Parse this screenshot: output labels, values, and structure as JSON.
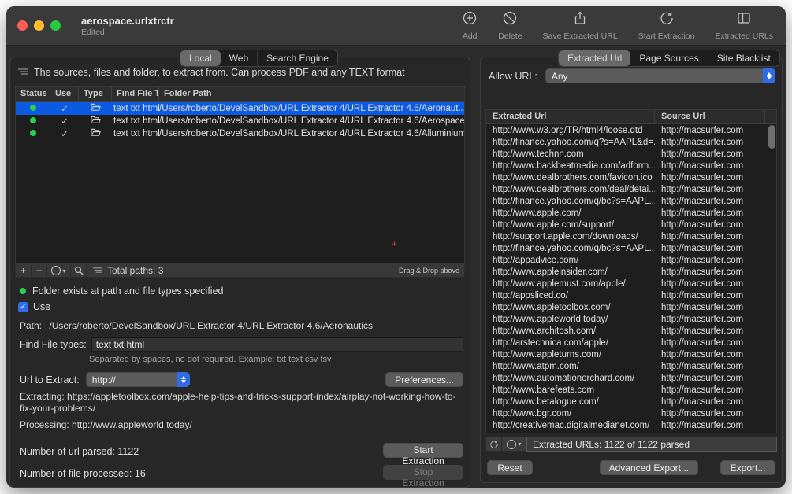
{
  "window": {
    "title": "aerospace.urlxtrctr",
    "subtitle": "Edited"
  },
  "toolbar": {
    "items": [
      {
        "label": "Add",
        "icon": "add-icon"
      },
      {
        "label": "Delete",
        "icon": "delete-icon"
      },
      {
        "label": "Save Extracted URL",
        "icon": "share-icon"
      },
      {
        "label": "Start Extraction",
        "icon": "refresh-icon"
      },
      {
        "label": "Extracted URLs",
        "icon": "columns-icon"
      }
    ]
  },
  "left": {
    "tabs": [
      {
        "label": "Local",
        "selected": true
      },
      {
        "label": "Web",
        "selected": false
      },
      {
        "label": "Search Engine",
        "selected": false
      }
    ],
    "description": "The sources, files and folder, to extract from. Can process PDF and any TEXT format",
    "table": {
      "columns": [
        "Status",
        "Use",
        "Type",
        "Find File Type",
        "Folder Path"
      ],
      "rows": [
        {
          "status": "green",
          "use": true,
          "type": "folder",
          "file_types": "text txt html",
          "path": "/Users/roberto/DevelSandbox/URL Extractor 4/URL Extractor 4.6/Aeronaut...",
          "selected": true
        },
        {
          "status": "green",
          "use": true,
          "type": "folder",
          "file_types": "text txt html",
          "path": "/Users/roberto/DevelSandbox/URL Extractor 4/URL Extractor 4.6/Aerospace",
          "selected": false
        },
        {
          "status": "green",
          "use": true,
          "type": "folder",
          "file_types": "text txt html",
          "path": "/Users/roberto/DevelSandbox/URL Extractor 4/URL Extractor 4.6/Alluminium",
          "selected": false
        }
      ]
    },
    "table_footer": {
      "add": "+",
      "remove": "−",
      "total": "Total paths: 3",
      "drag_hint": "Drag & Drop above"
    },
    "status_line": "Folder exists at path and file types specified",
    "use_checkbox": {
      "label": "Use",
      "checked": true
    },
    "path_label": "Path:",
    "path_value": "/Users/roberto/DevelSandbox/URL Extractor 4/URL Extractor 4.6/Aeronautics",
    "find_file_types": {
      "label": "Find File types:",
      "value": "text txt html",
      "hint": "Separated by spaces, no dot required. Example: txt text csv tsv"
    },
    "url_to_extract": {
      "label": "Url to Extract:",
      "value": "http://",
      "preferences_label": "Preferences..."
    },
    "extracting": "Extracting: https://appletoolbox.com/apple-help-tips-and-tricks-support-index/airplay-not-working-how-to-fix-your-problems/",
    "processing": "Processing: http://www.appleworld.today/",
    "url_parsed": "Number of url parsed: 1122",
    "files_processed": "Number of file processed: 16",
    "start_button": "Start Extraction",
    "stop_button": "Stop Extraction"
  },
  "right": {
    "tabs": [
      {
        "label": "Extracted Url",
        "selected": true
      },
      {
        "label": "Page Sources",
        "selected": false
      },
      {
        "label": "Site Blacklist",
        "selected": false
      }
    ],
    "allow_url": {
      "label": "Allow URL:",
      "value": "Any"
    },
    "table": {
      "columns": [
        "Extracted Url",
        "Source Url"
      ],
      "rows": [
        {
          "extracted": "http://www.w3.org/TR/html4/loose.dtd",
          "source": "http://macsurfer.com"
        },
        {
          "extracted": "http://finance.yahoo.com/q?s=AAPL&d=...",
          "source": "http://macsurfer.com"
        },
        {
          "extracted": "http://www.technn.com",
          "source": "http://macsurfer.com"
        },
        {
          "extracted": "http://www.backbeatmedia.com/adform...",
          "source": "http://macsurfer.com"
        },
        {
          "extracted": "http://www.dealbrothers.com/favicon.ico",
          "source": "http://macsurfer.com"
        },
        {
          "extracted": "http://www.dealbrothers.com/deal/detai...",
          "source": "http://macsurfer.com"
        },
        {
          "extracted": "http://finance.yahoo.com/q/bc?s=AAPL...",
          "source": "http://macsurfer.com"
        },
        {
          "extracted": "http://www.apple.com/",
          "source": "http://macsurfer.com"
        },
        {
          "extracted": "http://www.apple.com/support/",
          "source": "http://macsurfer.com"
        },
        {
          "extracted": "http://support.apple.com/downloads/",
          "source": "http://macsurfer.com"
        },
        {
          "extracted": "http://finance.yahoo.com/q/bc?s=AAPL...",
          "source": "http://macsurfer.com"
        },
        {
          "extracted": "http://appadvice.com/",
          "source": "http://macsurfer.com"
        },
        {
          "extracted": "http://www.appleinsider.com/",
          "source": "http://macsurfer.com"
        },
        {
          "extracted": "http://www.applemust.com/apple/",
          "source": "http://macsurfer.com"
        },
        {
          "extracted": "http://appsliced.co/",
          "source": "http://macsurfer.com"
        },
        {
          "extracted": "http://www.appletoolbox.com/",
          "source": "http://macsurfer.com"
        },
        {
          "extracted": "http://www.appleworld.today/",
          "source": "http://macsurfer.com"
        },
        {
          "extracted": "http://www.architosh.com/",
          "source": "http://macsurfer.com"
        },
        {
          "extracted": "http://arstechnica.com/apple/",
          "source": "http://macsurfer.com"
        },
        {
          "extracted": "http://www.appleturns.com/",
          "source": "http://macsurfer.com"
        },
        {
          "extracted": "http://www.atpm.com/",
          "source": "http://macsurfer.com"
        },
        {
          "extracted": "http://www.automationorchard.com/",
          "source": "http://macsurfer.com"
        },
        {
          "extracted": "http://www.barefeats.com",
          "source": "http://macsurfer.com"
        },
        {
          "extracted": "http://www.betalogue.com/",
          "source": "http://macsurfer.com"
        },
        {
          "extracted": "http://www.bgr.com/",
          "source": "http://macsurfer.com"
        },
        {
          "extracted": "http://creativemac.digitalmedianet.com/",
          "source": "http://macsurfer.com"
        }
      ]
    },
    "status_bar": "Extracted URLs: 1122 of  1122 parsed",
    "reset_button": "Reset",
    "advanced_export_button": "Advanced Export...",
    "export_button": "Export..."
  }
}
